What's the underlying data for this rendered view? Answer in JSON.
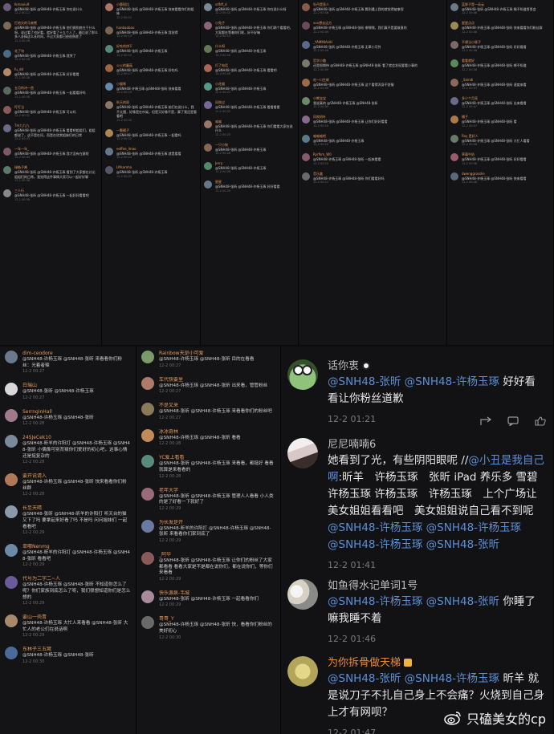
{
  "panels": {
    "col_a": [
      {
        "name": "Ikmaxiu9",
        "text": "@SNH48-张昕 @SNH48-许杨玉琢 你在说什么",
        "time": "12-2 00:11",
        "avatar": "#6b5a7a"
      },
      {
        "name": "打哈欠的马来熊",
        "text": "@SNH48-张昕 @SNH48-许杨玉琢 他们俩到底在干什么呀，说过看了也好看，就好看了十九个人了，最后说了那么多八卦搞这么长时间，不过大家都已经很熟悉了",
        "time": "12-2 00:26",
        "avatar": "#7a6b55"
      },
      {
        "name": "花了块",
        "text": "@SNH48-张昕 @SNH48-许杨玉琢 我哭了",
        "time": "12-2 00:28",
        "avatar": "#4a6b88"
      },
      {
        "name": "fu_dd",
        "text": "@SNH48-张昕 @SNH48-许杨玉琢 好好看看",
        "time": "12-2 00:28",
        "avatar": "#b58a6a"
      },
      {
        "name": "五月的诗一首",
        "text": "@SNH48-张昕 @SNH48-许杨玉琢 一起看看好吗",
        "time": "12-2 00:30",
        "avatar": "#5a6a5a"
      },
      {
        "name": "叮叮当",
        "text": "@SNH48-张昕 @SNH48-许杨玉琢 可以吗",
        "time": "12-2 00:31",
        "avatar": "#8a5a5a"
      },
      {
        "name": "Tm九九九",
        "text": "@SNH48-张昕 @SNH48-许杨玉琢 看看吧姐姐们，姐姐都说了，这不是在问，而是在欣赏姐妹们的日常",
        "time": "12-2 00:33",
        "avatar": "#6a6a8a"
      },
      {
        "name": "一年一年_",
        "text": "@SNH48-张昕 @SNH48-许杨玉琢 我才没有在意呢",
        "time": "12-2 00:34",
        "avatar": "#7a5a6a"
      },
      {
        "name": "绿柚子酱",
        "text": "@SNH48-张昕 @SNH48-许杨玉琢 看到了大家都在讨论姐姐们的日常，我觉得这件事情大家可以一起好好聊",
        "time": "12-2 00:36",
        "avatar": "#5a7a6a"
      },
      {
        "name": "三人行",
        "text": "@SNH48-张昕 @SNH48-许杨玉琢 一起好好看看吧",
        "time": "12-2 00:39",
        "avatar": "#888888"
      }
    ],
    "col_b": [
      {
        "name": "小鹿斑比",
        "text": "@SNH48-张昕 @SNH48-许杨玉琢 快来看看你们的姐妹",
        "time": "12-2 00:12",
        "avatar": "#aa7766"
      },
      {
        "name": "hanbaobao",
        "text": "@SNH48-张昕 @SNH48-许杨玉琢 我觉得",
        "time": "12-2 00:13",
        "avatar": "#776655"
      },
      {
        "name": "好吃的饼干",
        "text": "@SNH48-张昕 @SNH48-许杨玉琢",
        "time": "12-2 00:15",
        "avatar": "#558877"
      },
      {
        "name": "火火的蘑菇",
        "text": "@SNH48-张昕 @SNH48-许杨玉琢 好吃吗",
        "time": "12-2 00:17",
        "avatar": "#996644"
      },
      {
        "name": "小猫咪",
        "text": "@SNH48-许杨玉琢 @SNH48-张昕 快来看看",
        "time": "12-2 00:19",
        "avatar": "#6688aa"
      },
      {
        "name": "秋天的雨",
        "text": "@SNH48-张昕 @SNH48-许杨玉琢 她们在说什么，我不太懂，好像是在吵架，但是又好像不是，算了我还是看看吧",
        "time": "12-2 00:20",
        "avatar": "#887766"
      },
      {
        "name": "一颗橘子",
        "text": "@SNH48-张昕 @SNH48-许杨玉琢 一起看吗",
        "time": "12-2 00:22",
        "avatar": "#aa8855"
      },
      {
        "name": "eeffee_lmao",
        "text": "@SNH48-张昕 @SNH48-许杨玉琢 就是看看",
        "time": "12-2 00:24",
        "avatar": "#667788"
      },
      {
        "name": "LMsamha",
        "text": "@SNH48-张昕 @SNH48-许杨玉琢",
        "time": "12-2 00:25",
        "avatar": "#555566"
      }
    ],
    "col_c": [
      {
        "name": "sdfdf_d",
        "text": "@SNH48-张昕 @SNH48-许杨玉琢 你在说什么呀",
        "time": "12-2 00:10",
        "avatar": "#778899"
      },
      {
        "name": "小兔子",
        "text": "@SNH48-张昕 @SNH48-许杨玉琢 你们两个看看吧，大家都在等着你们呢，好不好嘛",
        "time": "12-2 00:13",
        "avatar": "#886677"
      },
      {
        "name": "什么呀",
        "text": "@SNH48-张昕 @SNH48-许杨玉琢",
        "time": "12-2 00:16",
        "avatar": "#667755"
      },
      {
        "name": "打了电话",
        "text": "@SNH48-张昕 @SNH48-许杨玉琢 看看吧",
        "time": "12-2 00:18",
        "avatar": "#aa6655"
      },
      {
        "name": "小花猫",
        "text": "@SNH48-张昕 @SNH48-许杨玉琢",
        "time": "12-2 00:21",
        "avatar": "#559988"
      },
      {
        "name": "风吹过",
        "text": "@SNH48-张昕 @SNH48-许杨玉琢 看看看看",
        "time": "12-2 00:22",
        "avatar": "#776699"
      },
      {
        "name": "喵喵",
        "text": "@SNH48-张昕 @SNH48-许杨玉琢 你们看看大家在说什么",
        "time": "12-2 00:23",
        "avatar": "#997766"
      },
      {
        "name": "一只小狗",
        "text": "@SNH48-张昕 @SNH48-许杨玉琢",
        "time": "12-2 00:26",
        "avatar": "#886655"
      },
      {
        "name": "Jerry",
        "text": "@SNH48-张昕 @SNH48-许杨玉琢",
        "time": "12-2 00:28",
        "avatar": "#558866"
      },
      {
        "name": "星星",
        "text": "@SNH48-张昕 @SNH48-许杨玉琢 好好看看",
        "time": "12-2 00:29",
        "avatar": "#667788"
      }
    ],
    "col_d": [
      {
        "name": "牡丹是恶人",
        "text": "@SNH48-张昕 @SNH48-许杨玉琢 舞到遇上我的就觉得被拿捏",
        "time": "12-2 00:08",
        "avatar": "#8a5a4a"
      },
      {
        "name": "xxx想去远方",
        "text": "@SNH48-许杨玉琢 @SNH48-张昕 哪嘿嘿，我们真不是要故意的",
        "time": "12-2 00:09",
        "avatar": "#6a4a5a"
      },
      {
        "name": "_YAMMIAHH",
        "text": "@SNH48-张昕 @SNH48-许杨玉琢 无辜小可怜",
        "time": "12-2 00:09",
        "avatar": "#5a6a8a"
      },
      {
        "name": "哲学小趣",
        "text": "还是很期待 @SNH48-许杨玉琢 @SNH48-张昕 看了就会发现要看小事的",
        "time": "12-2 00:09",
        "avatar": "#7a7a6a"
      },
      {
        "name": "吃一口生蚝",
        "text": "@SNH48-张昕 @SNH48-许杨玉琢 这个看得浑身不舒服",
        "time": "12-2 00:09",
        "avatar": "#9a6a4a"
      },
      {
        "name": "小熊宝宝",
        "text": "我说真的 @SNH48-许杨玉琢 @SNH48-张昕",
        "time": "12-2 00:09",
        "avatar": "#6a8a6a"
      },
      {
        "name": "风吹树叶",
        "text": "@SNH48-张昕 @SNH48-许杨玉琢 让你们好好看看",
        "time": "12-2 00:10",
        "avatar": "#8a6a8a"
      },
      {
        "name": "喵喵喵吧",
        "text": "@SNH48-张昕 @SNH48-许杨玉琢",
        "time": "12-2 00:10",
        "avatar": "#5a7a8a"
      },
      {
        "name": "Ryrfkm_W0",
        "text": "@SNH48-许杨玉琢 @SNH48-张昕 一起来看看",
        "time": "12-2 00:10",
        "avatar": "#8a5a6a"
      },
      {
        "name": "音乐盒",
        "text": "@SNH48-许杨玉琢 @SNH48-张昕 你们看看好吗",
        "time": "12-2 00:11",
        "avatar": "#6a6a6a"
      }
    ],
    "col_e": [
      {
        "name": "蓝胖子是一朵云",
        "text": "@SNH48-张昕 @SNH48-许杨玉琢 赐不知道哥哥会",
        "time": "12-2 00:06",
        "avatar": "#6a7a8a"
      },
      {
        "name": "星星点点",
        "text": "@SNH48-许杨玉琢 @SNH48-张昕 快来看看你们粉丝群",
        "time": "12-2 00:06",
        "avatar": "#9a8a5a"
      },
      {
        "name": "不想当小胖子",
        "text": "@SNH48-许杨玉琢 @SNH48-张昕 好好看看",
        "time": "12-2 00:06",
        "avatar": "#7a6a6a"
      },
      {
        "name": "看看就好",
        "text": "@SNH48-许杨玉琢 @SNH48-张昕 哪不知道",
        "time": "12-2 00:06",
        "avatar": "#5a8a5a"
      },
      {
        "name": "_Saindi",
        "text": "@SNH48-许杨玉琢 @SNH48-张昕 速度来看",
        "time": "12-2 00:07",
        "avatar": "#8a6a5a"
      },
      {
        "name": "多少个月亮",
        "text": "@SNH48-许杨玉琢 @SNH48-张昕 出来看看",
        "time": "12-2 00:07",
        "avatar": "#6a6a8a"
      },
      {
        "name": "橘子",
        "text": "@SNH48-许杨玉琢 @SNH48-张昕 看",
        "time": "12-2 00:07",
        "avatar": "#aa7a4a"
      },
      {
        "name": "Roy 是好人",
        "text": "@SNH48-许杨玉琢 @SNH48-张昕 大忙人看看",
        "time": "12-2 00:08",
        "avatar": "#6a7a6a"
      },
      {
        "name": "草莓牛奶",
        "text": "@SNH48-许杨玉琢 @SNH48-张昕 好好看看",
        "time": "12-2 00:08",
        "avatar": "#9a5a6a"
      },
      {
        "name": "dwenggrosslie",
        "text": "@SNH48-许杨玉琢 @SNH48-张昕 快来看看",
        "time": "12-2 00:08",
        "avatar": "#5a6a7a"
      }
    ],
    "col_f": [
      {
        "name": "dim-ceodore",
        "text": "@SNH48-许杨玉琢 @SNH48-张昕 来看看你们粉丝：光着者辣",
        "time": "12-2 00:27",
        "avatar": "#6b7a8a"
      },
      {
        "name": "白瑞山",
        "text": "@SNH48-张昕 @SNH48-许杨玉琢",
        "time": "12-2 00:27",
        "avatar": "#d8d8d8"
      },
      {
        "name": "SerrnginHall",
        "text": "@SNH48-许杨玉琢 @SNH48-张昕",
        "time": "12-2 00:28",
        "avatar": "#a07a8a"
      },
      {
        "name": "24SJeCek10",
        "text": "@SNH48-昕羊的许阳打 @SNH48-许杨玉琢 @SNH48-张昕 小偶像可别背叛你们爱好的初心吧，这事心情还是挺复杂的",
        "time": "12-2 00:28",
        "avatar": "#7a8a9a"
      },
      {
        "name": "要开说请入",
        "text": "@SNH48-许杨玉琢 @SNH48-张昕 快来看看你们粉丝群",
        "time": "12-2 00:28",
        "avatar": "#b07a5a"
      },
      {
        "name": "长至天晴",
        "text": "@SNH48-张昕 @SNH48-昕羊的许阳打 听天台的猫又下了吗 要拿起来好看了吗 不是吗 问问姐妹们 一起看看吧",
        "time": "12-2 00:29",
        "avatar": "#8a9aa8"
      },
      {
        "name": "单哪Nenmg",
        "text": "@SNH48-昕羊的许阳打 @SNH48-许杨玉琢 @SNH48-张昕 看看吧",
        "time": "12-2 00:29",
        "avatar": "#6a8aa8"
      },
      {
        "name": "代号为二字二~人",
        "text": "@SNH48-许杨玉琢 @SNH48-张昕 不知道你怎么了呢？你们家族到底怎么了呀，我们很想知道你们是怎么想的",
        "time": "12-2 00:29",
        "avatar": "#6a5a9a"
      },
      {
        "name": "要山一壳青",
        "text": "@SNH48-许杨玉琢 大忙人来看看 @SNH48-张昕 大忙人的老公们在说话啊",
        "time": "12-2 00:29",
        "avatar": "#a88a6a"
      },
      {
        "name": "东林子三五窝",
        "text": "@SNH48-许杨玉琢 @SNH48-张昕",
        "time": "12-2 00:30",
        "avatar": "#4a6a9a"
      }
    ],
    "col_g": [
      {
        "name": "Rainbow天是小可爱",
        "text": "@SNH48-许杨玉琢 @SNH48-张昕 目的在看看",
        "time": "12-2 00:27",
        "avatar": "#7a9a6a"
      },
      {
        "name": "车代快要里",
        "text": "@SNH48-许杨玉琢 @SNH48-张昕 出来看，管管粉丝",
        "time": "12-2 00:27",
        "avatar": "#b07a6a"
      },
      {
        "name": "不是又来",
        "text": "@SNH48-张昕 @SNH48-许杨玉琢 来看看你们的粉丝吧",
        "time": "12-2 00:27",
        "avatar": "#8a7a5a"
      },
      {
        "name": "冰冰奇林",
        "text": "@SNH48-许杨玉琢 @SNH48-张昕 看看",
        "time": "12-2 00:28",
        "avatar": "#c08a5a"
      },
      {
        "name": "YC爱上看看",
        "text": "@SNH48-张昕 @SNH48-许杨玉琢 来看看，都挺好 看看就算是来看看的",
        "time": "12-2 00:28",
        "avatar": "#5a8a7a"
      },
      {
        "name": "老年大学",
        "text": "@SNH48-张昕 @SNH48-许杨玉琢 管理人人看看 小人类的是了好看一下就好了",
        "time": "12-2 00:29",
        "avatar": "#9a6a7a"
      },
      {
        "name": "为长发是开",
        "text": "@SNH48-昕羊的许阳打 @SNH48-许杨玉琢 @SNH48-张昕 来看看你们家到底了",
        "time": "12-2 00:29",
        "avatar": "#6a7aa0"
      },
      {
        "name": "_阿华",
        "text": "@SNH48-张昕 @SNH48-许杨玉琢 让你们的粉丝了大家都看看 看看大家是不是都在说你们，都在说你们，等你们来看看",
        "time": "12-2 00:29",
        "avatar": "#8a5a5a"
      },
      {
        "name": "快乐源泉-韦城",
        "text": "@SNH48-张昕 @SNH48-许杨玉琢 一起看看你们",
        "time": "12-2 00:29",
        "avatar": "#a88a9a"
      },
      {
        "name": "哥哥_Y",
        "text": "@SNH48-许杨玉琢 @SNH48-张昕 快，看看你们粉丝的美好初心",
        "time": "12-2 00:30",
        "avatar": "#6a6a6a"
      }
    ]
  },
  "big_comments": [
    {
      "name": "话你衷",
      "name_gold": false,
      "badge": "panda",
      "avatar": "frog",
      "segments": [
        {
          "t": "@SNH48-张昕",
          "m": true
        },
        {
          "t": " ",
          "m": false
        },
        {
          "t": "@SNH48-许杨玉琢",
          "m": true
        },
        {
          "t": " 好好看看让你粉丝道歉",
          "m": false
        }
      ],
      "time": "12-2 01:21",
      "actions": true
    },
    {
      "name": "尼尼喃喃6",
      "name_gold": false,
      "badge": "",
      "avatar": "girl",
      "segments": [
        {
          "t": "她看到了光，有些阴阳眼呢 //",
          "m": false
        },
        {
          "t": "@小丑是我自己啊",
          "m": true
        },
        {
          "t": ":昕羊　许杨玉琢　张昕 iPad 养乐多 雪碧　许杨玉琢 许杨玉琢　许杨玉琢　上个广场让美女姐姐看看吧　美女姐姐说自己看不到呢",
          "m": false
        },
        {
          "t": " ",
          "m": false
        },
        {
          "t": "@SNH48-许杨玉琢",
          "m": true
        },
        {
          "t": " ",
          "m": false
        },
        {
          "t": "@SNH48-许杨玉琢",
          "m": true
        },
        {
          "t": " ",
          "m": false
        },
        {
          "t": "@SNH48-许杨玉琢",
          "m": true
        },
        {
          "t": " ",
          "m": false
        },
        {
          "t": "@SNH48-张昕",
          "m": true
        }
      ],
      "time": "12-2 01:41",
      "actions": false
    },
    {
      "name": "如鱼得水记单词1号",
      "name_gold": false,
      "badge": "",
      "avatar": "flowers",
      "segments": [
        {
          "t": "@SNH48-许杨玉琢",
          "m": true
        },
        {
          "t": " ",
          "m": false
        },
        {
          "t": "@SNH48-张昕",
          "m": true
        },
        {
          "t": " 你睡了嘛我睡不着",
          "m": false
        }
      ],
      "time": "12-2 01:46",
      "actions": false
    },
    {
      "name": "为你拆骨做天梯",
      "name_gold": true,
      "badge": "crown",
      "avatar": "yellow",
      "segments": [
        {
          "t": "@SNH48-张昕",
          "m": true
        },
        {
          "t": " ",
          "m": false
        },
        {
          "t": "@SNH48-许杨玉琢",
          "m": true
        },
        {
          "t": " 昕羊 就是说刀子不扎自己身上不会痛？火烧到自己身上才有网呗？",
          "m": false
        }
      ],
      "time": "12-2 01:47",
      "actions": false
    }
  ],
  "watermark": {
    "text": "只磕美女的cp",
    "icon": "weibo-logo"
  },
  "colors": {
    "mention": "#5b8fd6",
    "name_gold": "#e88a2c",
    "background": "#121214"
  }
}
